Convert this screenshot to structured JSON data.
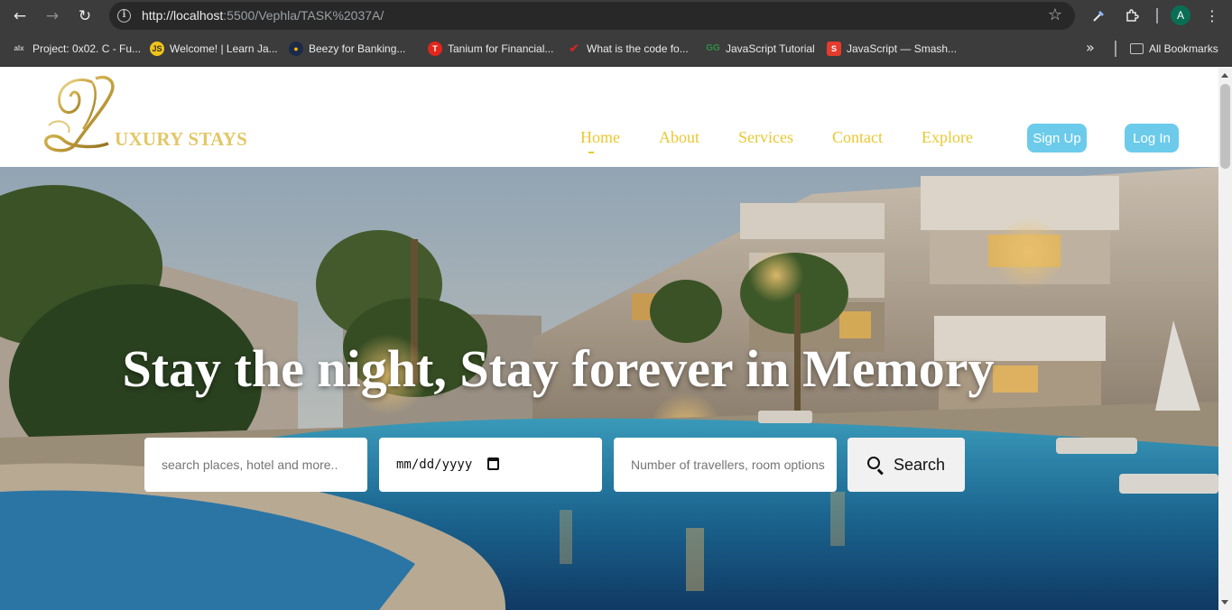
{
  "browser": {
    "url_host": "http://localhost",
    "url_rest": ":5500/Vephla/TASK%2037A/",
    "profile_initial": "A",
    "bookmarks": [
      {
        "label": "Project: 0x02. C - Fu...",
        "icon": "alx-icon"
      },
      {
        "label": "Welcome! | Learn Ja...",
        "icon": "js-icon"
      },
      {
        "label": "Beezy for Banking...",
        "icon": "beezy-icon"
      },
      {
        "label": "Tanium for Financial...",
        "icon": "tanium-icon"
      },
      {
        "label": "What is the code fo...",
        "icon": "code-icon"
      },
      {
        "label": "JavaScript Tutorial",
        "icon": "gfg-icon"
      },
      {
        "label": "JavaScript — Smash...",
        "icon": "smashing-icon"
      }
    ],
    "all_bookmarks_label": "All Bookmarks"
  },
  "site": {
    "logo_text": "UXURY STAYS",
    "nav": [
      "Home",
      "About",
      "Services",
      "Contact",
      "Explore"
    ],
    "signup_label": "Sign Up",
    "login_label": "Log In"
  },
  "hero": {
    "title": "Stay the night, Stay forever in Memory",
    "search_placeholder": "search places, hotel and more..",
    "date_placeholder": "mm/dd/yyyy",
    "travellers_placeholder": "Number of travellers, room options",
    "search_button_label": "Search"
  },
  "colors": {
    "gold": "#e9c832",
    "pill_blue": "#6ccbea",
    "chrome": "#3c3c3c"
  }
}
